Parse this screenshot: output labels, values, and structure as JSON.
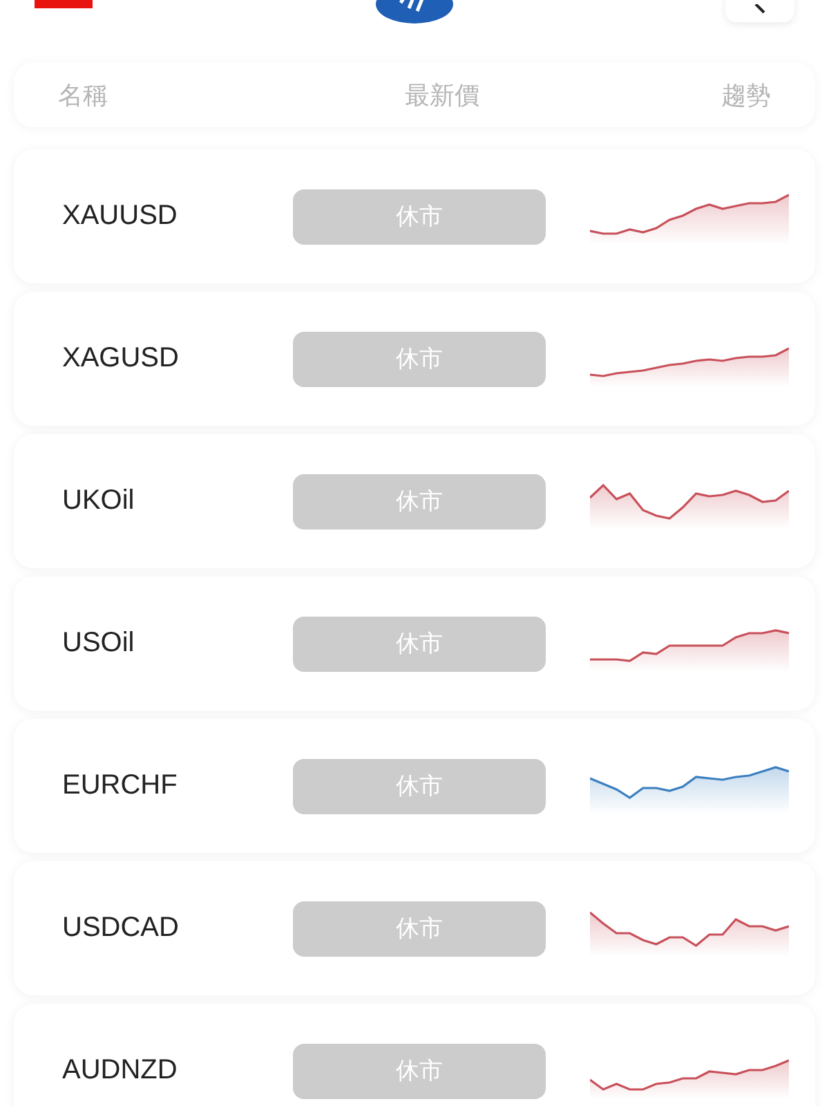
{
  "header": {
    "columns": [
      "名稱",
      "最新價",
      "趨勢"
    ]
  },
  "rows": [
    {
      "name": "XAUUSD",
      "price": "休市",
      "color": "#c8505a"
    },
    {
      "name": "XAGUSD",
      "price": "休市",
      "color": "#c8505a"
    },
    {
      "name": "UKOil",
      "price": "休市",
      "color": "#c8505a"
    },
    {
      "name": "USOil",
      "price": "休市",
      "color": "#c8505a"
    },
    {
      "name": "EURCHF",
      "price": "休市",
      "color": "#3a7fc0"
    },
    {
      "name": "USDCAD",
      "price": "休市",
      "color": "#c8505a"
    },
    {
      "name": "AUDNZD",
      "price": "休市",
      "color": "#c8505a"
    }
  ]
}
